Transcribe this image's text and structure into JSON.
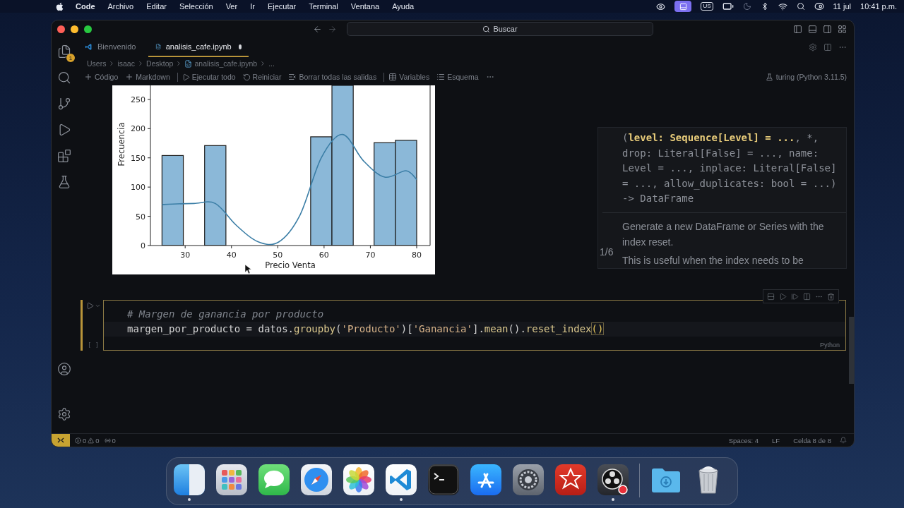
{
  "menu_bar": {
    "app": "Code",
    "menus": [
      "Archivo",
      "Editar",
      "Selección",
      "Ver",
      "Ir",
      "Ejecutar",
      "Terminal",
      "Ventana",
      "Ayuda"
    ],
    "input_source": "US",
    "date": "11 jul",
    "time": "10:41 p.m."
  },
  "title_bar": {
    "search": {
      "placeholder": "Buscar"
    }
  },
  "activity_bar": {
    "explorer_badge": "1"
  },
  "tabs": [
    {
      "label": "Bienvenido",
      "kind": "welcome",
      "selected": false,
      "dirty": false
    },
    {
      "label": "analisis_cafe.ipynb",
      "kind": "notebook",
      "selected": true,
      "dirty": true
    }
  ],
  "breadcrumbs": [
    {
      "label": "Users",
      "kind": "folder"
    },
    {
      "label": "isaac",
      "kind": "folder"
    },
    {
      "label": "Desktop",
      "kind": "folder"
    },
    {
      "label": "analisis_cafe.ipynb",
      "kind": "file"
    },
    {
      "label": "...",
      "kind": "more"
    }
  ],
  "notebook_toolbar": {
    "actions": [
      {
        "label": "Código",
        "kind": "add"
      },
      {
        "label": "Markdown",
        "kind": "add"
      },
      {
        "label": "Ejecutar todo",
        "kind": "run-all"
      },
      {
        "label": "Reiniciar",
        "kind": "restart"
      },
      {
        "label": "Borrar todas las salidas",
        "kind": "clear"
      },
      {
        "label": "Variables",
        "kind": "variables"
      },
      {
        "label": "Esquema",
        "kind": "outline"
      }
    ],
    "kernel": "turing (Python 3.11.5)"
  },
  "output": {
    "chart_data": {
      "type": "bar",
      "xlabel": "Precio Venta",
      "ylabel": "Frecuencia",
      "x": [
        25,
        27.3,
        31.9,
        36.5,
        41.0,
        45.6,
        50.2,
        54.8,
        59.4,
        64.0,
        68.5,
        73.1,
        77.7,
        80
      ],
      "series": [
        {
          "type": "bar",
          "color": "#8bb8d8",
          "values": [
            null,
            154,
            0,
            171,
            0,
            0,
            0,
            0,
            186,
            274,
            0,
            176,
            180,
            null
          ]
        },
        {
          "type": "line",
          "color": "#3b7ea6",
          "values": [
            70,
            71,
            72,
            72,
            35,
            7,
            6,
            52,
            150,
            190,
            145,
            117,
            128,
            113
          ]
        }
      ],
      "stacked": false,
      "xlim": [
        22.5,
        82.9
      ],
      "ylim": [
        0,
        274
      ],
      "xticks": [
        30,
        40,
        50,
        60,
        70,
        80
      ],
      "yticks": [
        0,
        50,
        100,
        150,
        200,
        250
      ]
    }
  },
  "hover": {
    "signature_open": "(",
    "active_param": "level: Sequence[Level] = ...",
    "signature_rest": ", *, drop: Literal[False] = ..., name: Level = ..., inplace: Literal[False] = ..., allow_duplicates: bool = ...) -> DataFrame",
    "description": [
      "Generate a new DataFrame or Series with the index reset.",
      "This is useful when the index needs to be"
    ],
    "counter": "1/6"
  },
  "cell": {
    "comment": "# Margen de ganancia por producto",
    "tokens": [
      {
        "text": "margen_por_producto",
        "kind": "name"
      },
      {
        "text": " = ",
        "kind": "op"
      },
      {
        "text": "datos",
        "kind": "name"
      },
      {
        "text": ".",
        "kind": "op"
      },
      {
        "text": "groupby",
        "kind": "func"
      },
      {
        "text": "(",
        "kind": "op"
      },
      {
        "text": "'Producto'",
        "kind": "string"
      },
      {
        "text": ")[",
        "kind": "op"
      },
      {
        "text": "'Ganancia'",
        "kind": "string"
      },
      {
        "text": "].",
        "kind": "op"
      },
      {
        "text": "mean",
        "kind": "func"
      },
      {
        "text": "().",
        "kind": "op"
      },
      {
        "text": "reset_index",
        "kind": "func"
      },
      {
        "text": "()",
        "kind": "match"
      }
    ],
    "execution_count": "[ ]",
    "language": "Python",
    "focused": true
  },
  "status_bar": {
    "errors": "0",
    "warnings": "0",
    "ports": "0",
    "items": [
      "Spaces: 4",
      "LF",
      "Celda 8 de 8"
    ]
  },
  "dock": {
    "apps": [
      {
        "kind": "finder",
        "running": true
      },
      {
        "kind": "launchpad",
        "running": false
      },
      {
        "kind": "messages",
        "running": false
      },
      {
        "kind": "safari",
        "running": false
      },
      {
        "kind": "photos",
        "running": false
      },
      {
        "kind": "vscode",
        "running": true
      },
      {
        "kind": "terminal",
        "running": false
      },
      {
        "kind": "appstore",
        "running": false
      },
      {
        "kind": "settings",
        "running": false
      },
      {
        "kind": "wolfram",
        "running": false
      },
      {
        "kind": "obs",
        "running": true
      }
    ],
    "stacks": [
      {
        "kind": "downloads",
        "running": false
      },
      {
        "kind": "trash",
        "running": false
      }
    ]
  }
}
